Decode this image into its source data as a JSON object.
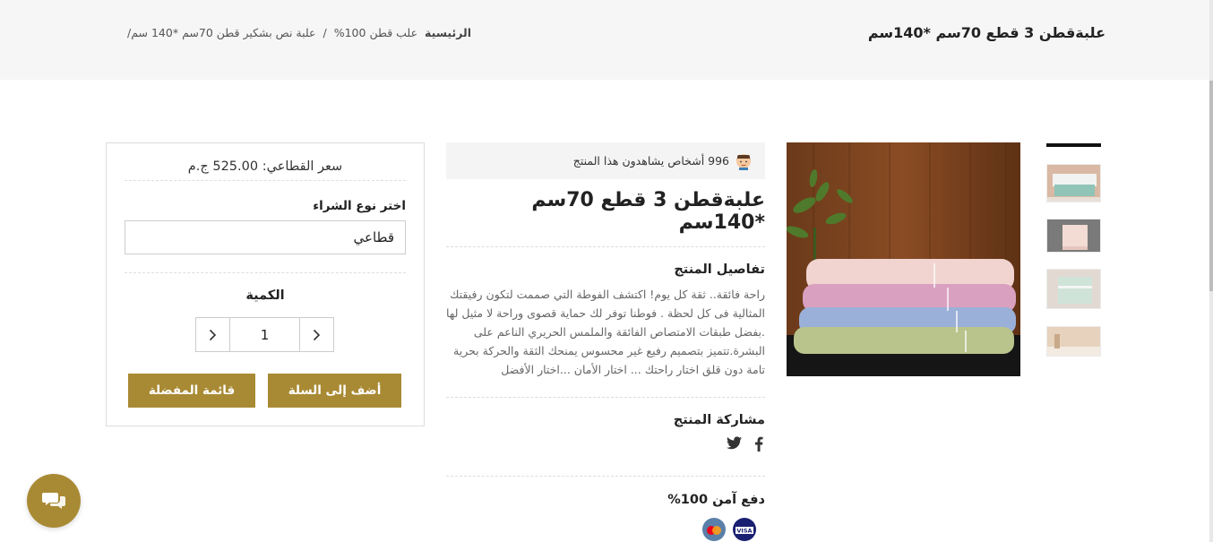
{
  "header": {
    "page_title": "علبةقطن 3 قطع 70سم *140سم",
    "breadcrumb": {
      "home": "الرئيسية",
      "category": "علب قطن 100%",
      "separator": "/",
      "current": "علبة نص بشكير قطن 70سم *140 سم/"
    }
  },
  "gallery": {
    "main_image_icon": "towels-photo",
    "thumbnails": [
      "towels-thumb-1",
      "towels-thumb-2",
      "towels-thumb-3",
      "towels-thumb-4",
      "towels-thumb-5"
    ]
  },
  "product": {
    "viewers_text": "996 أشخاص يشاهدون هذا المنتج",
    "title": "علبةقطن 3 قطع 70سم *140سم",
    "details_title": "تفاصيل المنتج",
    "description": "راحة فائقة.. ثقة كل يوم! اكتشف الفوطة التي صممت لتكون رفيقتك المثالية فى كل لحظة . فوطنا توفر لك حماية قصوى وراحة لا مثيل لها .بفضل طبقات الامتصاص الفائقة والملمس الحريري الناعم على البشرة.تتميز بتصميم رفيع غير محسوس يمنحك الثقة والحركة بحرية تامة دون قلق اختار راحتك ... اختار الأمان ...اختار الأفضل",
    "share_title": "مشاركة المنتج",
    "share_icons": [
      "facebook-icon",
      "twitter-icon"
    ],
    "secure_title": "دفع آمن 100%",
    "payment_cards": [
      "visa-icon",
      "mastercard-icon"
    ],
    "visa_text": "VISA"
  },
  "purchase": {
    "price_text": "سعر القطاعي: 525.00 ج.م",
    "type_label": "اختر نوع الشراء",
    "type_value": "قطاعي",
    "quantity_label": "الكمية",
    "quantity_value": "1",
    "add_to_cart": "أضف إلى السلة",
    "wishlist": "قائمة المفضلة"
  },
  "colors": {
    "accent": "#a98a34",
    "topbar_bg": "#f6f6f6"
  }
}
